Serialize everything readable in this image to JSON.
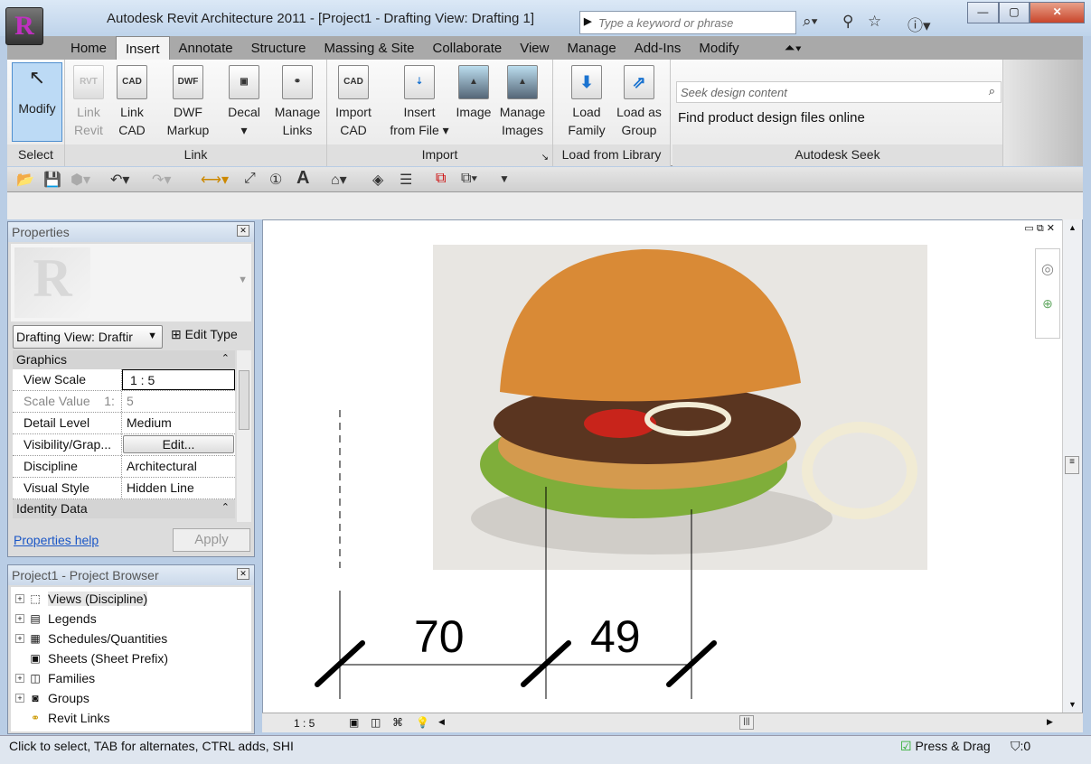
{
  "window": {
    "title": "Autodesk Revit Architecture 2011 - [Project1 - Drafting View: Drafting 1]",
    "app_letter": "R",
    "search_placeholder": "Type a keyword or phrase"
  },
  "tabs": [
    "Home",
    "Insert",
    "Annotate",
    "Structure",
    "Massing & Site",
    "Collaborate",
    "View",
    "Manage",
    "Add-Ins",
    "Modify"
  ],
  "active_tab": "Insert",
  "ribbon": {
    "select": {
      "label": "Select",
      "modify": "Modify"
    },
    "link": {
      "label": "Link",
      "buttons": [
        {
          "l1": "Link",
          "l2": "Revit",
          "icon": "RVT"
        },
        {
          "l1": "Link",
          "l2": "CAD",
          "icon": "CAD"
        },
        {
          "l1": "DWF",
          "l2": "Markup",
          "icon": "DWF"
        },
        {
          "l1": "Decal",
          "l2": "▾",
          "icon": "▣"
        },
        {
          "l1": "Manage",
          "l2": "Links",
          "icon": "⚭"
        }
      ]
    },
    "import": {
      "label": "Import",
      "buttons": [
        {
          "l1": "Import",
          "l2": "CAD",
          "icon": "CAD"
        },
        {
          "l1": "Insert",
          "l2": "from File ▾",
          "icon": "⇣"
        },
        {
          "l1": "Image",
          "l2": "",
          "icon": "▲"
        },
        {
          "l1": "Manage",
          "l2": "Images",
          "icon": "▲"
        }
      ]
    },
    "library": {
      "label": "Load from Library",
      "buttons": [
        {
          "l1": "Load",
          "l2": "Family",
          "icon": "⬇"
        },
        {
          "l1": "Load as",
          "l2": "Group",
          "icon": "⇗"
        }
      ]
    },
    "seek": {
      "label": "Autodesk Seek",
      "placeholder": "Seek design content",
      "text": "Find product design files online"
    }
  },
  "properties": {
    "title": "Properties",
    "type_selector": "Drafting View: Draftir",
    "edit_type": "Edit Type",
    "groups": [
      {
        "name": "Graphics"
      },
      {
        "name": "Identity Data"
      }
    ],
    "rows": [
      {
        "k": "View Scale",
        "v": "1 : 5"
      },
      {
        "k": "Scale Value    1:",
        "v": "5"
      },
      {
        "k": "Detail Level",
        "v": "Medium"
      },
      {
        "k": "Visibility/Grap...",
        "v": "Edit..."
      },
      {
        "k": "Discipline",
        "v": "Architectural"
      },
      {
        "k": "Visual Style",
        "v": "Hidden Line"
      }
    ],
    "help": "Properties help",
    "apply": "Apply"
  },
  "browser": {
    "title": "Project1 - Project Browser",
    "items": [
      "Views (Discipline)",
      "Legends",
      "Schedules/Quantities",
      "Sheets (Sheet Prefix)",
      "Families",
      "Groups",
      "Revit Links"
    ]
  },
  "canvas": {
    "dim1": "70",
    "dim2": "49",
    "scale": "1 : 5"
  },
  "status": {
    "text": "Click to select, TAB for alternates, CTRL adds, SHI",
    "press_drag": "Press & Drag",
    "filter": ":0"
  }
}
